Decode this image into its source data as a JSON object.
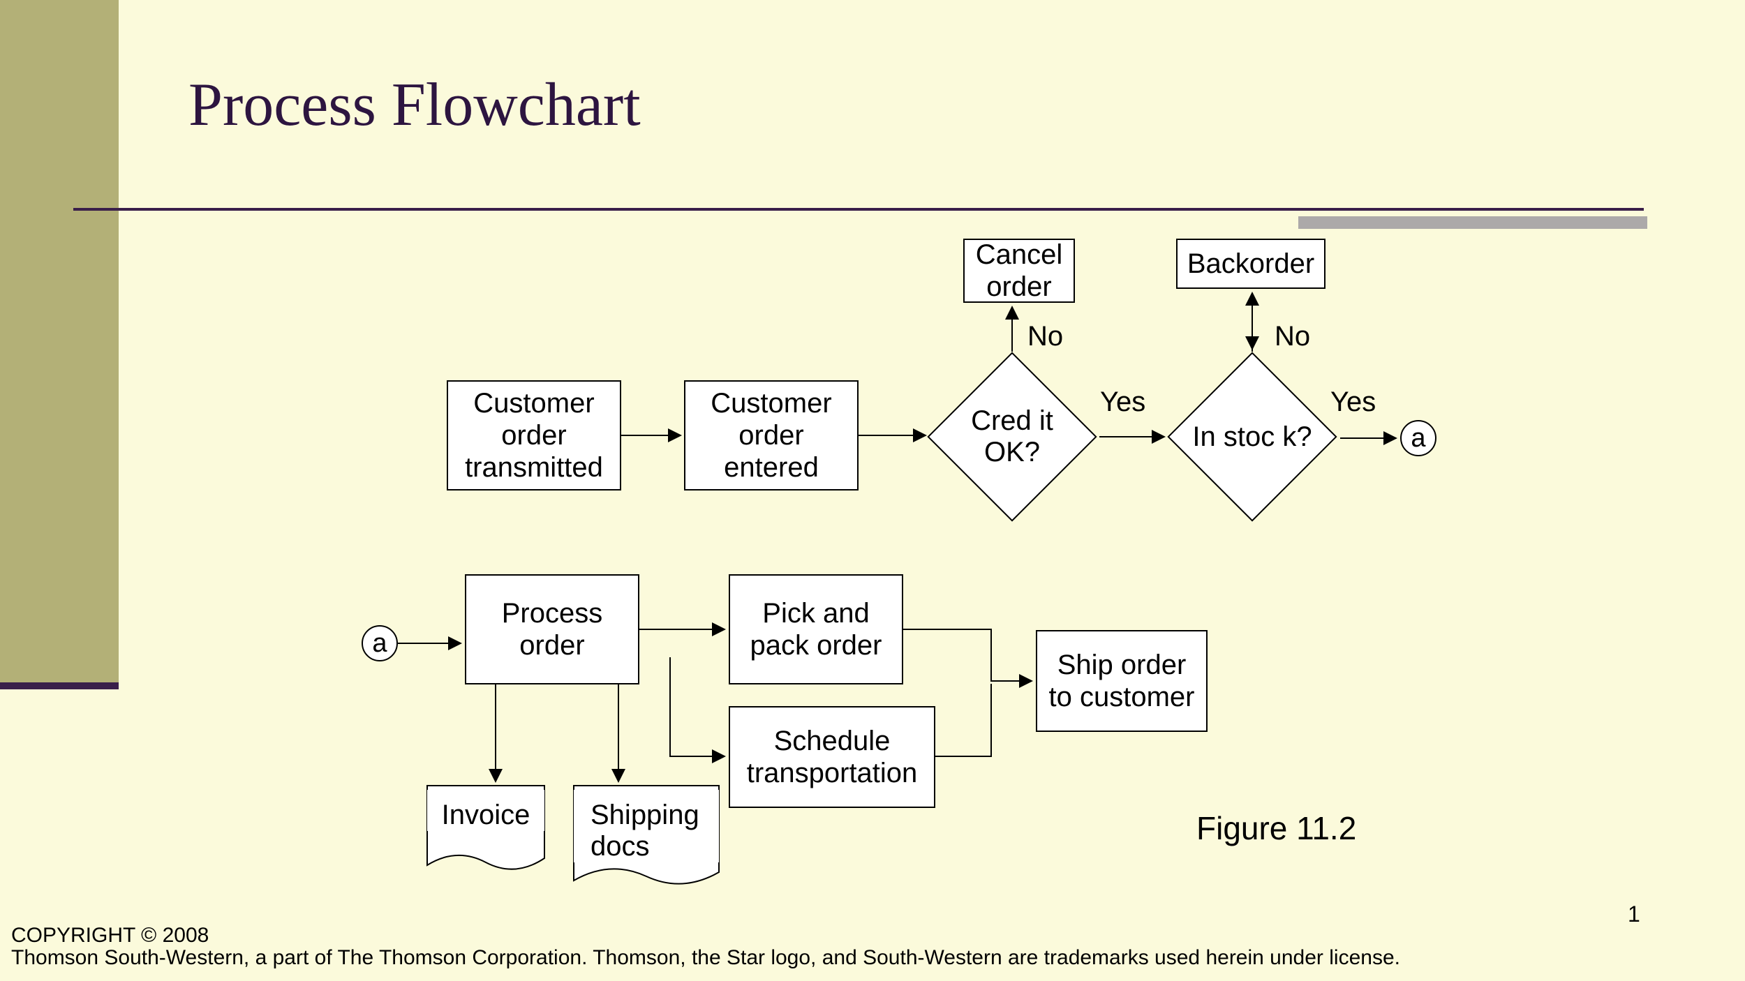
{
  "title": "Process Flowchart",
  "nodes": {
    "transmitted": "Customer order transmitted",
    "entered": "Customer order entered",
    "credit": "Cred it OK?",
    "instock": "In stoc k?",
    "cancel": "Cancel order",
    "backorder": "Backorder",
    "connector_a": "a",
    "connector_a2": "a",
    "process": "Process order",
    "pickpack": "Pick and pack order",
    "schedule": "Schedule transportation",
    "ship": "Ship order to customer",
    "invoice": "Invoice",
    "shipdocs": "Shipping docs"
  },
  "edges": {
    "no": "No",
    "yes": "Yes"
  },
  "figure_label": "Figure 11.2",
  "page_number": "1",
  "copyright_line1": "COPYRIGHT © 2008",
  "copyright_line2": "Thomson South-Western, a part of The Thomson Corporation. Thomson, the Star logo, and South-Western are trademarks used herein under license."
}
